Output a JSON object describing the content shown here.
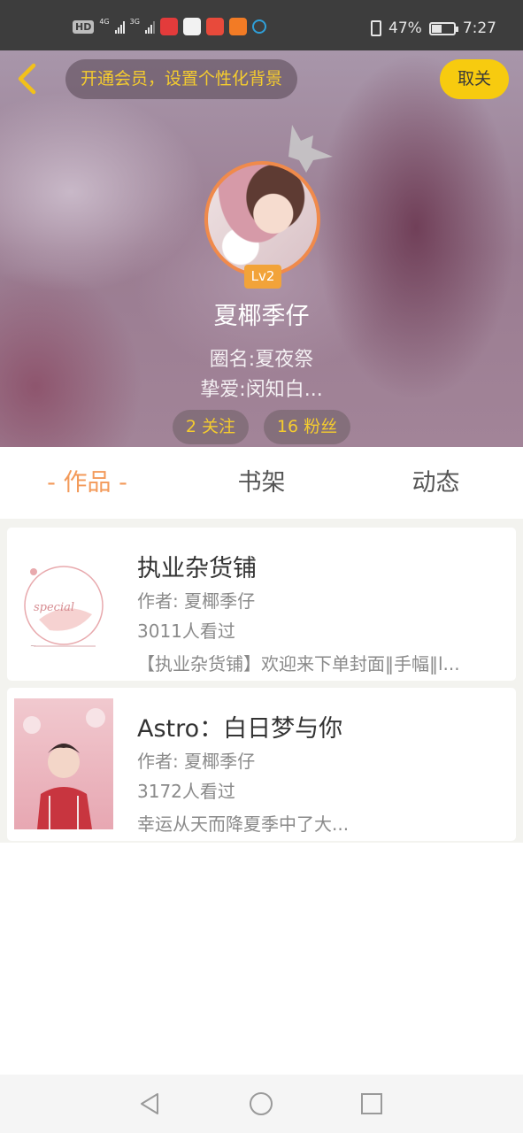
{
  "status_bar": {
    "hd": "HD",
    "hd_sub": "1",
    "net1": "4G",
    "net2": "3G",
    "battery": "47%",
    "time": "7:27",
    "battery_level": 0.47,
    "app_icons": [
      {
        "name": "toutiao-app-icon",
        "color": "#e33b3b"
      },
      {
        "name": "paw-app-icon",
        "color": "#f2f2f2"
      },
      {
        "name": "book-app-icon",
        "color": "#e84a3b"
      },
      {
        "name": "taobao-app-icon",
        "color": "#f27b25"
      },
      {
        "name": "headset-app-icon",
        "color": "#2f9fd8"
      }
    ]
  },
  "header": {
    "vip_text": "开通会员，设置个性化背景",
    "unfollow_label": "取关",
    "level": "Lv2",
    "username": "夏椰季仔",
    "circle_name": "圈名:夏夜祭",
    "fav": "挚爱:闵知白...",
    "following": "2 关注",
    "followers": "16 粉丝"
  },
  "tabs": [
    {
      "label": "- 作品 -",
      "active": true
    },
    {
      "label": "书架",
      "active": false
    },
    {
      "label": "动态",
      "active": false
    }
  ],
  "works": [
    {
      "title": "执业杂货铺",
      "author": "作者: 夏椰季仔",
      "views": "3011人看过",
      "desc": "【执业杂货铺】欢迎来下单封面‖手幅‖l..."
    },
    {
      "title": "Astro：白日梦与你",
      "author": "作者: 夏椰季仔",
      "views": "3172人看过",
      "desc": "幸运从天而降夏季中了大..."
    }
  ],
  "colors": {
    "accent": "#f39a5a",
    "gold": "#f5cc2e",
    "unfollow_bg": "#f7cb0f"
  }
}
